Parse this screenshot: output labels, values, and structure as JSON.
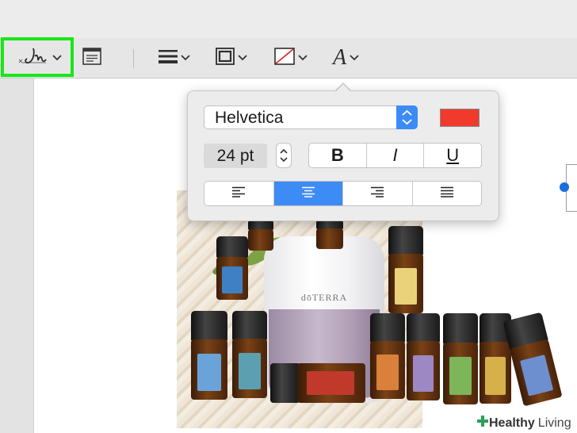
{
  "toolbar": {
    "items": [
      {
        "name": "signature",
        "icon": "signature-icon",
        "has_menu": true,
        "highlighted": true
      },
      {
        "name": "note",
        "icon": "note-icon",
        "has_menu": false
      },
      {
        "name": "line-style",
        "icon": "line-style-icon",
        "has_menu": true
      },
      {
        "name": "border-color",
        "icon": "border-color-icon",
        "has_menu": true
      },
      {
        "name": "fill-color",
        "icon": "fill-color-icon",
        "has_menu": true
      },
      {
        "name": "text-style",
        "icon": "text-style-icon",
        "has_menu": true
      }
    ],
    "highlight_color": "#19e619",
    "text_style_glyph": "A"
  },
  "text_popover": {
    "font_family": "Helvetica",
    "font_size": "24 pt",
    "color": "#ef3a2c",
    "bold_label": "B",
    "italic_label": "I",
    "underline_label": "U",
    "alignments": [
      "left",
      "center",
      "right",
      "justify"
    ],
    "selected_alignment": "center",
    "accent_color": "#3d8bf5"
  },
  "photo": {
    "diffuser_logo": "dōTERRA"
  },
  "watermark": {
    "brand": "Healthy",
    "suffix": "Living"
  }
}
